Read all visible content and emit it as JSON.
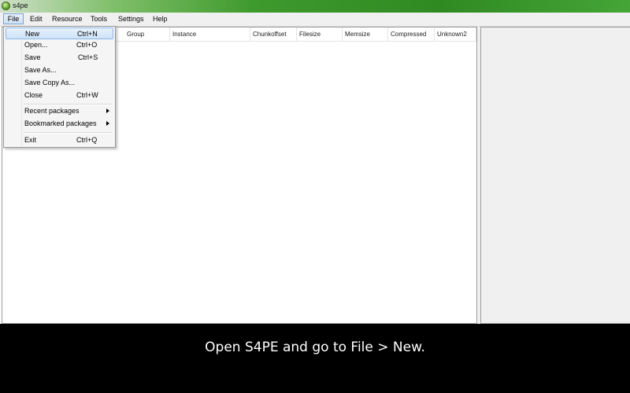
{
  "window": {
    "title": "s4pe"
  },
  "menubar": {
    "items": [
      {
        "label": "File"
      },
      {
        "label": "Edit"
      },
      {
        "label": "Resource"
      },
      {
        "label": "Tools"
      },
      {
        "label": "Settings"
      },
      {
        "label": "Help"
      }
    ]
  },
  "file_menu": {
    "items": [
      {
        "label": "New",
        "shortcut": "Ctrl+N",
        "highlighted": true
      },
      {
        "label": "Open...",
        "shortcut": "Ctrl+O"
      },
      {
        "label": "Save",
        "shortcut": "Ctrl+S"
      },
      {
        "label": "Save As...",
        "shortcut": ""
      },
      {
        "label": "Save Copy As...",
        "shortcut": ""
      },
      {
        "label": "Close",
        "shortcut": "Ctrl+W"
      },
      {
        "label": "Recent packages",
        "submenu": true
      },
      {
        "label": "Bookmarked packages",
        "submenu": true
      },
      {
        "label": "Exit",
        "shortcut": "Ctrl+Q"
      }
    ]
  },
  "resource_list": {
    "columns": [
      "Group",
      "Instance",
      "Chunkoffset",
      "Filesize",
      "Memsize",
      "Compressed",
      "Unknown2"
    ]
  },
  "caption": "Open S4PE and go to File > New.",
  "colors": {
    "menu_highlight": "#cce2f8",
    "titlebar_green": "#3f9a2d",
    "caption_bg": "#000000"
  }
}
